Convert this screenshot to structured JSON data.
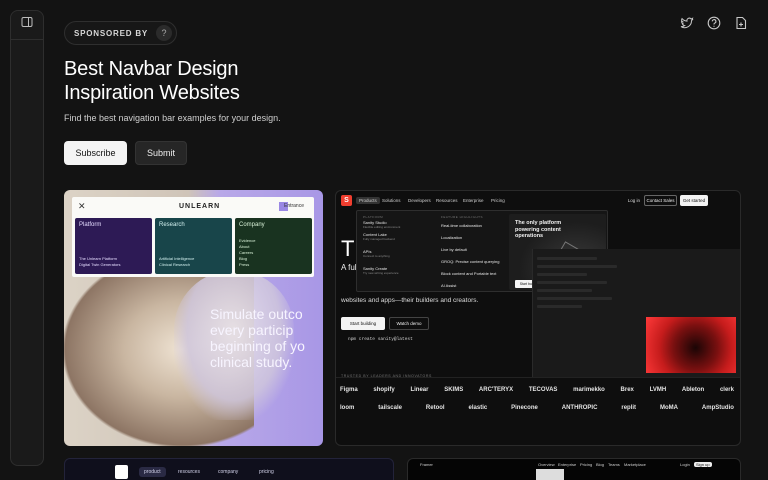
{
  "sponsor": {
    "label": "SPONSORED BY",
    "help": "?"
  },
  "hero": {
    "title": "Best Navbar Design Inspiration Websites",
    "subtitle": "Find the best navigation bar examples for your design."
  },
  "actions": {
    "subscribe": "Subscribe",
    "submit": "Submit"
  },
  "header_icons": [
    "twitter-icon",
    "help-icon",
    "submit-icon"
  ],
  "cards": [
    {
      "brand": "UNLEARN",
      "enter": "Entrance",
      "menu": {
        "platform": {
          "title": "Platform",
          "items": [
            "The Unlearn Platform",
            "Digital Twin Generators"
          ]
        },
        "research": {
          "title": "Research",
          "items": [
            "Artificial Intelligence",
            "Clinical Research"
          ]
        },
        "company": {
          "title": "Company",
          "items": [
            "Evidence",
            "About",
            "Careers",
            "Blog",
            "Press"
          ]
        }
      },
      "headline": "Simulate outco every particip beginning of yo clinical study."
    },
    {
      "brand_initial": "S",
      "nav": [
        "Products",
        "Solutions",
        "Developers",
        "Resources",
        "Enterprise",
        "Pricing"
      ],
      "login": "Log in",
      "contact": "Contact Sales",
      "get_started": "Get started",
      "dropdown": {
        "platform_header": "PLATFORM",
        "platform_items": [
          {
            "title": "Sanity Studio",
            "sub": "Flexible editing environment"
          },
          {
            "title": "Content Lake",
            "sub": "Fully managed backend"
          },
          {
            "title": "APIs",
            "sub": "Connect to anything"
          },
          {
            "title": "Sanity Create",
            "sub": "Try new writing experience"
          }
        ],
        "features_header": "FEATURE HIGHLIGHTS",
        "feature_items": [
          "Real-time collaboration",
          "Localization",
          "Live by default",
          "GROQ: Precise content querying",
          "Block content and Portable text",
          "AI Assist"
        ],
        "promo_title": "The only platform powering content operations",
        "promo_highlight": "content operations",
        "promo_button": "Start building for free"
      },
      "hero_letter": "T",
      "hero_line2": "A ful",
      "hero_tail": "websites and apps—their builders and creators.",
      "cta_primary": "Start building",
      "cta_secondary": "Watch demo",
      "npm": "npm create sanity@latest",
      "trusted": "TRUSTED BY LEADERS AND INNOVATORS",
      "logos_row1": [
        "Figma",
        "shopify",
        "Linear",
        "SKIMS",
        "ARC'TERYX",
        "TECOVAS",
        "marimekko",
        "Brex",
        "LVMH",
        "Ableton",
        "clerk"
      ],
      "logos_row2": [
        "loom",
        "tailscale",
        "Retool",
        "elastic",
        "Pinecone",
        "ANTHROPIC",
        "replit",
        "MoMA",
        "AmpStudio"
      ]
    },
    {
      "nav": [
        "product",
        "resources",
        "company",
        "pricing"
      ]
    },
    {
      "brand": "Framer",
      "nav": [
        "Overview",
        "Enterprise",
        "Pricing",
        "Blog",
        "Teams",
        "Marketplace"
      ],
      "login": "Login",
      "signup": "Sign up"
    }
  ]
}
